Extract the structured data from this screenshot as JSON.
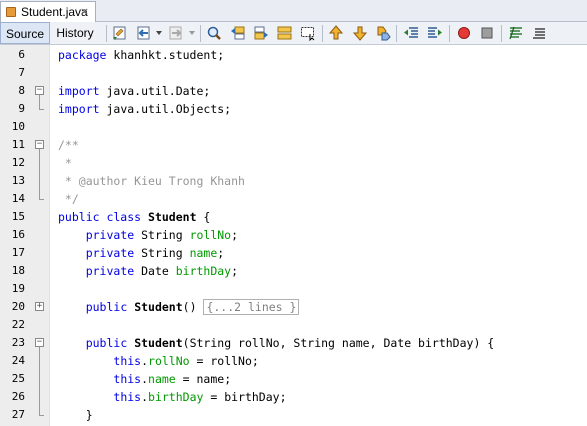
{
  "tab": {
    "file_name": "Student.java",
    "close_glyph": "×",
    "file_icon": "java-file-icon"
  },
  "toolbar": {
    "source_label": "Source",
    "history_label": "History",
    "buttons": [
      "last-edit-icon",
      "back-icon",
      "forward-icon",
      "find-icon",
      "find-previous-icon",
      "find-next-icon",
      "find-selection-icon",
      "toggle-highlight-icon",
      "previous-bookmark-icon",
      "next-bookmark-icon",
      "toggle-bookmark-icon",
      "shift-left-icon",
      "shift-right-icon",
      "start-macro-icon",
      "stop-macro-icon",
      "comment-icon",
      "uncomment-icon"
    ]
  },
  "editor": {
    "lines": [
      {
        "n": "6",
        "fold": "",
        "tokens": [
          [
            "kw",
            "package"
          ],
          [
            "t",
            " khanhkt.student;"
          ]
        ]
      },
      {
        "n": "7",
        "fold": "",
        "tokens": []
      },
      {
        "n": "8",
        "fold": "-",
        "tokens": [
          [
            "kw",
            "import"
          ],
          [
            "t",
            " java.util.Date;"
          ]
        ]
      },
      {
        "n": "9",
        "fold": "",
        "tokens": [
          [
            "kw",
            "import"
          ],
          [
            "t",
            " java.util.Objects;"
          ]
        ]
      },
      {
        "n": "10",
        "fold": "",
        "tokens": []
      },
      {
        "n": "11",
        "fold": "-",
        "tokens": [
          [
            "cmt",
            "/**"
          ]
        ]
      },
      {
        "n": "12",
        "fold": "",
        "tokens": [
          [
            "cmt",
            " *"
          ]
        ]
      },
      {
        "n": "13",
        "fold": "",
        "tokens": [
          [
            "cmt",
            " * @author Kieu Trong Khanh"
          ]
        ]
      },
      {
        "n": "14",
        "fold": "",
        "tokens": [
          [
            "cmt",
            " */"
          ]
        ]
      },
      {
        "n": "15",
        "fold": "",
        "tokens": [
          [
            "kw",
            "public class"
          ],
          [
            "t",
            " "
          ],
          [
            "cls",
            "Student"
          ],
          [
            "t",
            " {"
          ]
        ]
      },
      {
        "n": "16",
        "fold": "",
        "tokens": [
          [
            "t",
            "    "
          ],
          [
            "kw",
            "private"
          ],
          [
            "t",
            " String "
          ],
          [
            "fld",
            "rollNo"
          ],
          [
            "t",
            ";"
          ]
        ]
      },
      {
        "n": "17",
        "fold": "",
        "tokens": [
          [
            "t",
            "    "
          ],
          [
            "kw",
            "private"
          ],
          [
            "t",
            " String "
          ],
          [
            "fld",
            "name"
          ],
          [
            "t",
            ";"
          ]
        ]
      },
      {
        "n": "18",
        "fold": "",
        "tokens": [
          [
            "t",
            "    "
          ],
          [
            "kw",
            "private"
          ],
          [
            "t",
            " Date "
          ],
          [
            "fld",
            "birthDay"
          ],
          [
            "t",
            ";"
          ]
        ]
      },
      {
        "n": "19",
        "fold": "",
        "tokens": []
      },
      {
        "n": "20",
        "fold": "+",
        "tokens": [
          [
            "t",
            "    "
          ],
          [
            "kw",
            "public"
          ],
          [
            "t",
            " "
          ],
          [
            "cls",
            "Student"
          ],
          [
            "t",
            "() "
          ],
          [
            "folded",
            "{...2 lines }"
          ]
        ]
      },
      {
        "n": "22",
        "fold": "",
        "tokens": []
      },
      {
        "n": "23",
        "fold": "-",
        "tokens": [
          [
            "t",
            "    "
          ],
          [
            "kw",
            "public"
          ],
          [
            "t",
            " "
          ],
          [
            "cls",
            "Student"
          ],
          [
            "t",
            "(String rollNo, String name, Date birthDay) {"
          ]
        ]
      },
      {
        "n": "24",
        "fold": "",
        "tokens": [
          [
            "t",
            "        "
          ],
          [
            "kw",
            "this"
          ],
          [
            "t",
            "."
          ],
          [
            "fld",
            "rollNo"
          ],
          [
            "t",
            " = rollNo;"
          ]
        ]
      },
      {
        "n": "25",
        "fold": "",
        "tokens": [
          [
            "t",
            "        "
          ],
          [
            "kw",
            "this"
          ],
          [
            "t",
            "."
          ],
          [
            "fld",
            "name"
          ],
          [
            "t",
            " = name;"
          ]
        ]
      },
      {
        "n": "26",
        "fold": "",
        "tokens": [
          [
            "t",
            "        "
          ],
          [
            "kw",
            "this"
          ],
          [
            "t",
            "."
          ],
          [
            "fld",
            "birthDay"
          ],
          [
            "t",
            " = birthDay;"
          ]
        ]
      },
      {
        "n": "27",
        "fold": "",
        "tokens": [
          [
            "t",
            "    }"
          ]
        ]
      }
    ]
  },
  "colors": {
    "keyword": "#0000e6",
    "field": "#009900",
    "comment": "#969696",
    "gutter": "#ededed"
  }
}
